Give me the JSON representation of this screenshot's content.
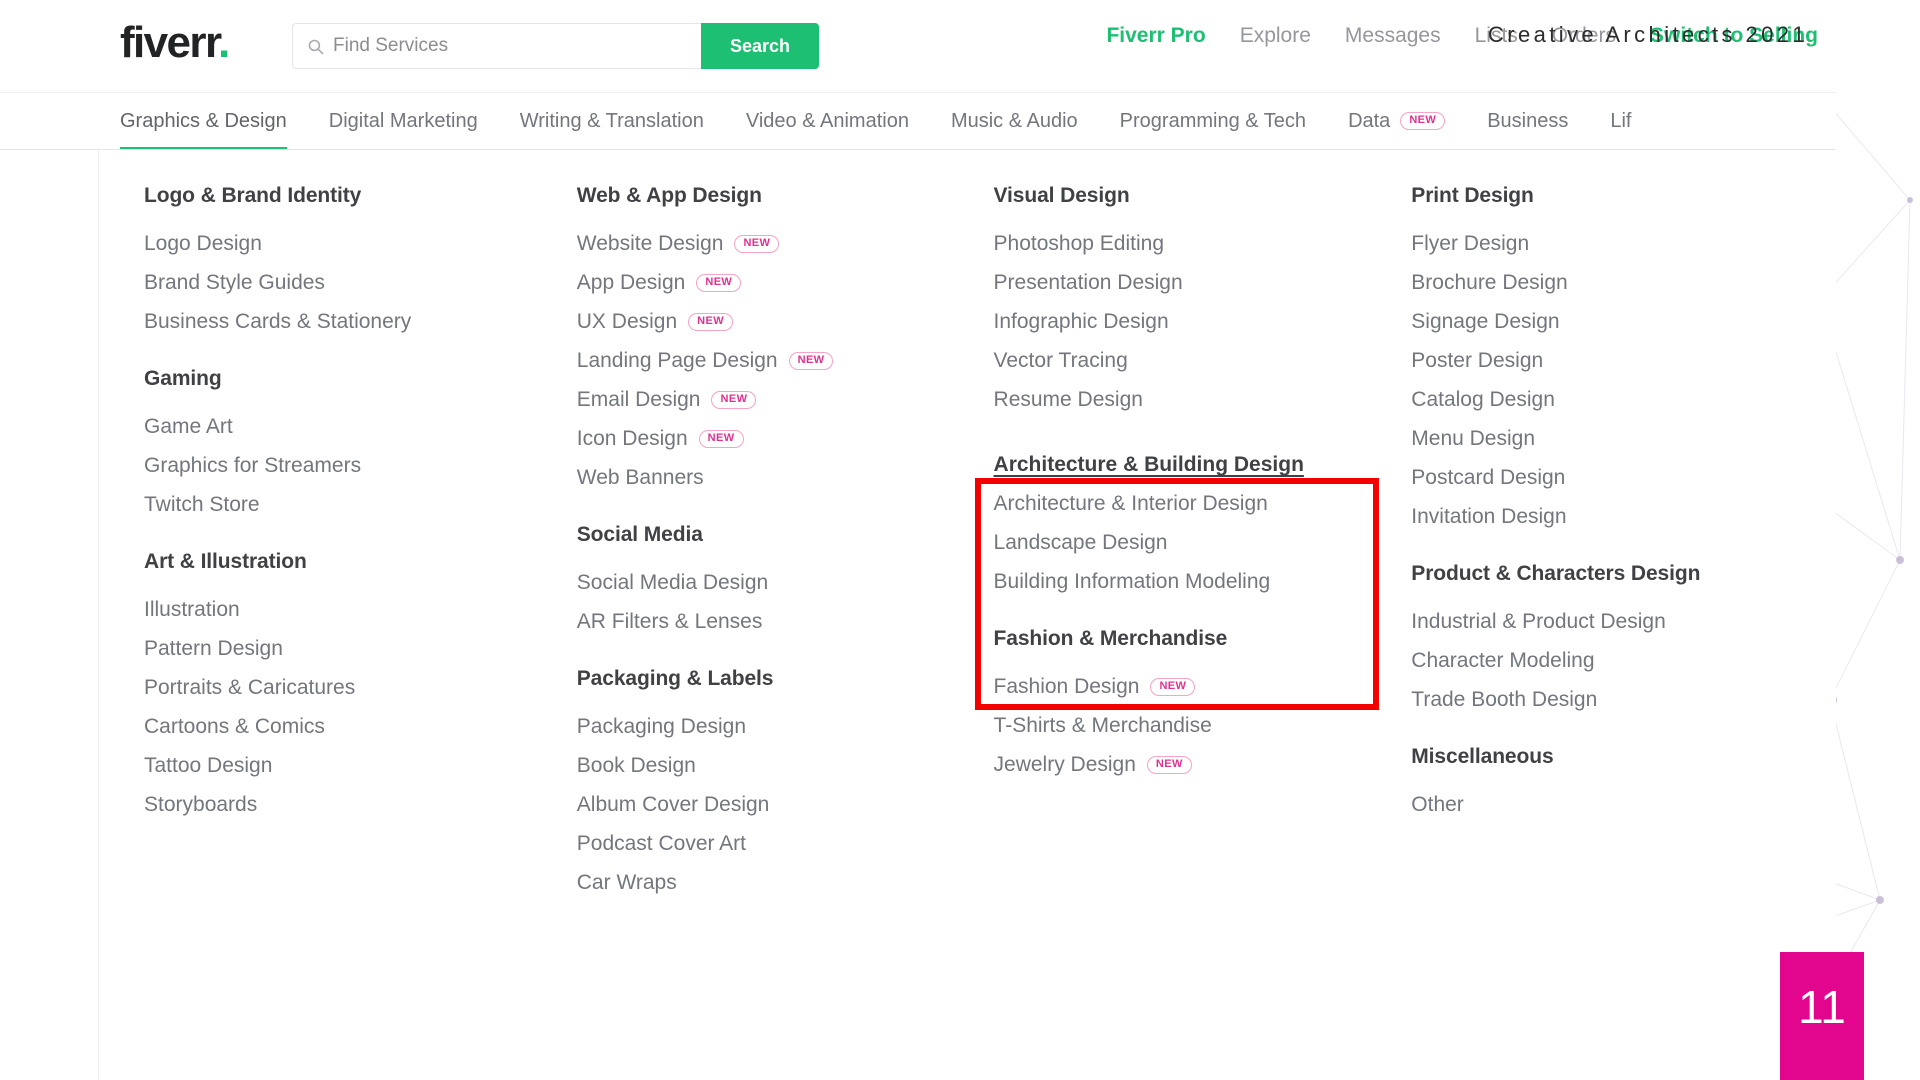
{
  "brand": {
    "logo_text": "fiverr",
    "logo_dot": ".",
    "accent_green": "#1dbf73",
    "badge_pink": "#e0318f",
    "annotation_red": "#f40000",
    "counter_magenta": "#e2068f"
  },
  "search": {
    "placeholder": "Find Services",
    "value": "",
    "button_label": "Search",
    "icon": "search-icon"
  },
  "top_nav": {
    "items": [
      {
        "label": "Fiverr Pro",
        "style": "pro"
      },
      {
        "label": "Explore",
        "style": "plain"
      },
      {
        "label": "Messages",
        "style": "plain"
      },
      {
        "label": "Lists",
        "style": "plain"
      },
      {
        "label": "Orders",
        "style": "plain"
      },
      {
        "label": "Switch to Selling",
        "style": "green"
      }
    ],
    "overlay_text": "Creative Architects 2021"
  },
  "category_bar": {
    "items": [
      {
        "label": "Graphics & Design",
        "active": true,
        "badge": ""
      },
      {
        "label": "Digital Marketing",
        "active": false,
        "badge": ""
      },
      {
        "label": "Writing & Translation",
        "active": false,
        "badge": ""
      },
      {
        "label": "Video & Animation",
        "active": false,
        "badge": ""
      },
      {
        "label": "Music & Audio",
        "active": false,
        "badge": ""
      },
      {
        "label": "Programming & Tech",
        "active": false,
        "badge": ""
      },
      {
        "label": "Data",
        "active": false,
        "badge": "NEW"
      },
      {
        "label": "Business",
        "active": false,
        "badge": ""
      },
      {
        "label": "Lif",
        "active": false,
        "badge": ""
      }
    ]
  },
  "megamenu": {
    "columns": [
      {
        "groups": [
          {
            "title": "Logo & Brand Identity",
            "links": [
              {
                "label": "Logo Design",
                "badge": "",
                "highlighted": false
              },
              {
                "label": "Brand Style Guides",
                "badge": "",
                "highlighted": false
              },
              {
                "label": "Business Cards & Stationery",
                "badge": "",
                "highlighted": false
              }
            ]
          },
          {
            "title": "Gaming",
            "links": [
              {
                "label": "Game Art",
                "badge": "",
                "highlighted": false
              },
              {
                "label": "Graphics for Streamers",
                "badge": "",
                "highlighted": false
              },
              {
                "label": "Twitch Store",
                "badge": "",
                "highlighted": false
              }
            ]
          },
          {
            "title": "Art & Illustration",
            "links": [
              {
                "label": "Illustration",
                "badge": "",
                "highlighted": false
              },
              {
                "label": "Pattern Design",
                "badge": "",
                "highlighted": false
              },
              {
                "label": "Portraits & Caricatures",
                "badge": "",
                "highlighted": false
              },
              {
                "label": "Cartoons & Comics",
                "badge": "",
                "highlighted": false
              },
              {
                "label": "Tattoo Design",
                "badge": "",
                "highlighted": false
              },
              {
                "label": "Storyboards",
                "badge": "",
                "highlighted": false
              }
            ]
          }
        ]
      },
      {
        "groups": [
          {
            "title": "Web & App Design",
            "links": [
              {
                "label": "Website Design",
                "badge": "NEW",
                "highlighted": false
              },
              {
                "label": "App Design",
                "badge": "NEW",
                "highlighted": false
              },
              {
                "label": "UX Design",
                "badge": "NEW",
                "highlighted": false
              },
              {
                "label": "Landing Page Design",
                "badge": "NEW",
                "highlighted": false
              },
              {
                "label": "Email Design",
                "badge": "NEW",
                "highlighted": false
              },
              {
                "label": "Icon Design",
                "badge": "NEW",
                "highlighted": false
              },
              {
                "label": "Web Banners",
                "badge": "",
                "highlighted": false
              }
            ]
          },
          {
            "title": "Social Media",
            "links": [
              {
                "label": "Social Media Design",
                "badge": "",
                "highlighted": false
              },
              {
                "label": "AR Filters & Lenses",
                "badge": "",
                "highlighted": false
              }
            ]
          },
          {
            "title": "Packaging & Labels",
            "links": [
              {
                "label": "Packaging Design",
                "badge": "",
                "highlighted": false
              },
              {
                "label": "Book Design",
                "badge": "",
                "highlighted": false
              },
              {
                "label": "Album Cover Design",
                "badge": "",
                "highlighted": false
              },
              {
                "label": "Podcast Cover Art",
                "badge": "",
                "highlighted": false
              },
              {
                "label": "Car Wraps",
                "badge": "",
                "highlighted": false
              }
            ]
          }
        ]
      },
      {
        "groups": [
          {
            "title": "Visual Design",
            "links": [
              {
                "label": "Photoshop Editing",
                "badge": "",
                "highlighted": false
              },
              {
                "label": "Presentation Design",
                "badge": "",
                "highlighted": false
              },
              {
                "label": "Infographic Design",
                "badge": "",
                "highlighted": false
              },
              {
                "label": "Vector Tracing",
                "badge": "",
                "highlighted": false
              },
              {
                "label": "Resume Design",
                "badge": "",
                "highlighted": false
              }
            ]
          },
          {
            "title": "",
            "links": [
              {
                "label": "Architecture & Building Design",
                "badge": "",
                "highlighted": true
              },
              {
                "label": "Architecture & Interior Design",
                "badge": "",
                "highlighted": false
              },
              {
                "label": "Landscape Design",
                "badge": "",
                "highlighted": false
              },
              {
                "label": "Building Information Modeling",
                "badge": "",
                "highlighted": false
              }
            ]
          },
          {
            "title": "Fashion & Merchandise",
            "links": [
              {
                "label": "Fashion Design",
                "badge": "NEW",
                "highlighted": false
              },
              {
                "label": "T-Shirts & Merchandise",
                "badge": "",
                "highlighted": false
              },
              {
                "label": "Jewelry Design",
                "badge": "NEW",
                "highlighted": false
              }
            ]
          }
        ]
      },
      {
        "groups": [
          {
            "title": "Print Design",
            "links": [
              {
                "label": "Flyer Design",
                "badge": "",
                "highlighted": false
              },
              {
                "label": "Brochure Design",
                "badge": "",
                "highlighted": false
              },
              {
                "label": "Signage Design",
                "badge": "",
                "highlighted": false
              },
              {
                "label": "Poster Design",
                "badge": "",
                "highlighted": false
              },
              {
                "label": "Catalog Design",
                "badge": "",
                "highlighted": false
              },
              {
                "label": "Menu Design",
                "badge": "",
                "highlighted": false
              },
              {
                "label": "Postcard Design",
                "badge": "",
                "highlighted": false
              },
              {
                "label": "Invitation Design",
                "badge": "",
                "highlighted": false
              }
            ]
          },
          {
            "title": "Product & Characters Design",
            "links": [
              {
                "label": "Industrial & Product Design",
                "badge": "",
                "highlighted": false
              },
              {
                "label": "Character Modeling",
                "badge": "",
                "highlighted": false
              },
              {
                "label": "Trade Booth Design",
                "badge": "",
                "highlighted": false
              }
            ]
          },
          {
            "title": "Miscellaneous",
            "links": [
              {
                "label": "Other",
                "badge": "",
                "highlighted": false
              }
            ]
          }
        ]
      }
    ]
  },
  "annotations": {
    "highlight_box_label": "architecture-building-design-highlight",
    "counter": "11"
  }
}
